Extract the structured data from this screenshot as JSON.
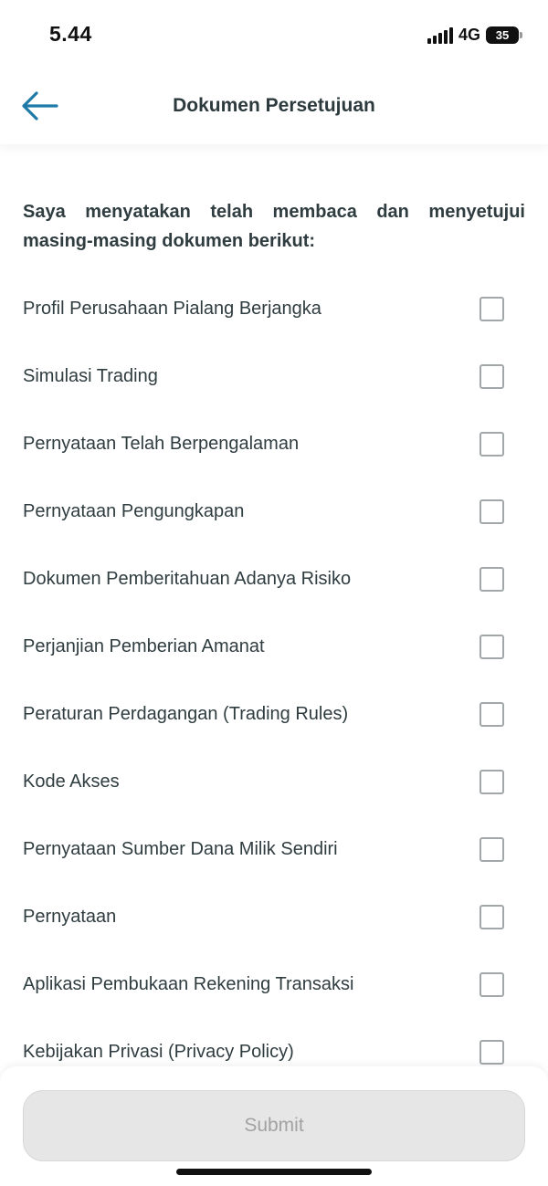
{
  "status_bar": {
    "time": "5.44",
    "network": "4G",
    "battery": "35"
  },
  "header": {
    "title": "Dokumen Persetujuan",
    "back_icon": "arrow-left-icon"
  },
  "intro_text": "Saya menyatakan telah membaca dan menyetujui masing-masing dokumen berikut:",
  "documents": [
    {
      "label": "Profil Perusahaan Pialang Berjangka",
      "checked": false
    },
    {
      "label": "Simulasi Trading",
      "checked": false
    },
    {
      "label": "Pernyataan Telah Berpengalaman",
      "checked": false
    },
    {
      "label": "Pernyataan Pengungkapan",
      "checked": false
    },
    {
      "label": "Dokumen Pemberitahuan Adanya Risiko",
      "checked": false
    },
    {
      "label": "Perjanjian Pemberian Amanat",
      "checked": false
    },
    {
      "label": "Peraturan Perdagangan (Trading Rules)",
      "checked": false
    },
    {
      "label": "Kode Akses",
      "checked": false
    },
    {
      "label": "Pernyataan Sumber Dana Milik Sendiri",
      "checked": false
    },
    {
      "label": "Pernyataan",
      "checked": false
    },
    {
      "label": "Aplikasi Pembukaan Rekening Transaksi",
      "checked": false
    },
    {
      "label": "Kebijakan Privasi (Privacy Policy)",
      "checked": false
    }
  ],
  "submit_label": "Submit",
  "colors": {
    "accent": "#1f7aa8",
    "text": "#2f3c40",
    "checkbox_border": "#a2a8aa",
    "submit_disabled_bg": "#e6e6e6",
    "submit_disabled_text": "#a2a2a2"
  }
}
